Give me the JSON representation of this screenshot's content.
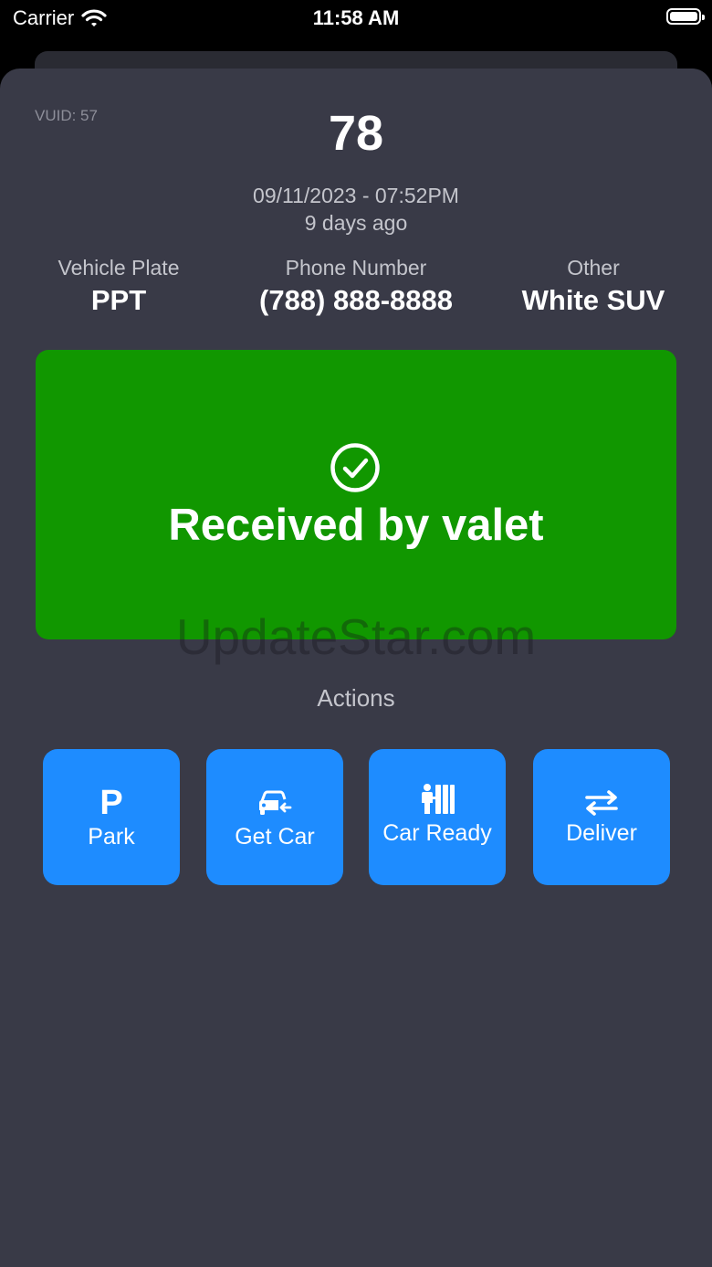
{
  "status_bar": {
    "carrier": "Carrier",
    "time": "11:58 AM"
  },
  "ticket": {
    "vuid": "VUID: 57",
    "number": "78",
    "datetime": "09/11/2023 - 07:52PM",
    "age": "9 days ago"
  },
  "info": {
    "plate_label": "Vehicle Plate",
    "plate_value": "PPT",
    "phone_label": "Phone Number",
    "phone_value": "(788) 888-8888",
    "other_label": "Other",
    "other_value": "White SUV"
  },
  "status": {
    "icon": "checkmark-circle-icon",
    "text": "Received by valet",
    "color": "#119700"
  },
  "watermark": "UpdateStar.com",
  "actions": {
    "title": "Actions",
    "color": "#1e8cff",
    "buttons": [
      {
        "label": "Park",
        "icon": "parking-icon"
      },
      {
        "label": "Get Car",
        "icon": "car-arrow-icon"
      },
      {
        "label": "Car Ready",
        "icon": "valet-person-icon"
      },
      {
        "label": "Deliver",
        "icon": "swap-arrows-icon"
      }
    ]
  }
}
